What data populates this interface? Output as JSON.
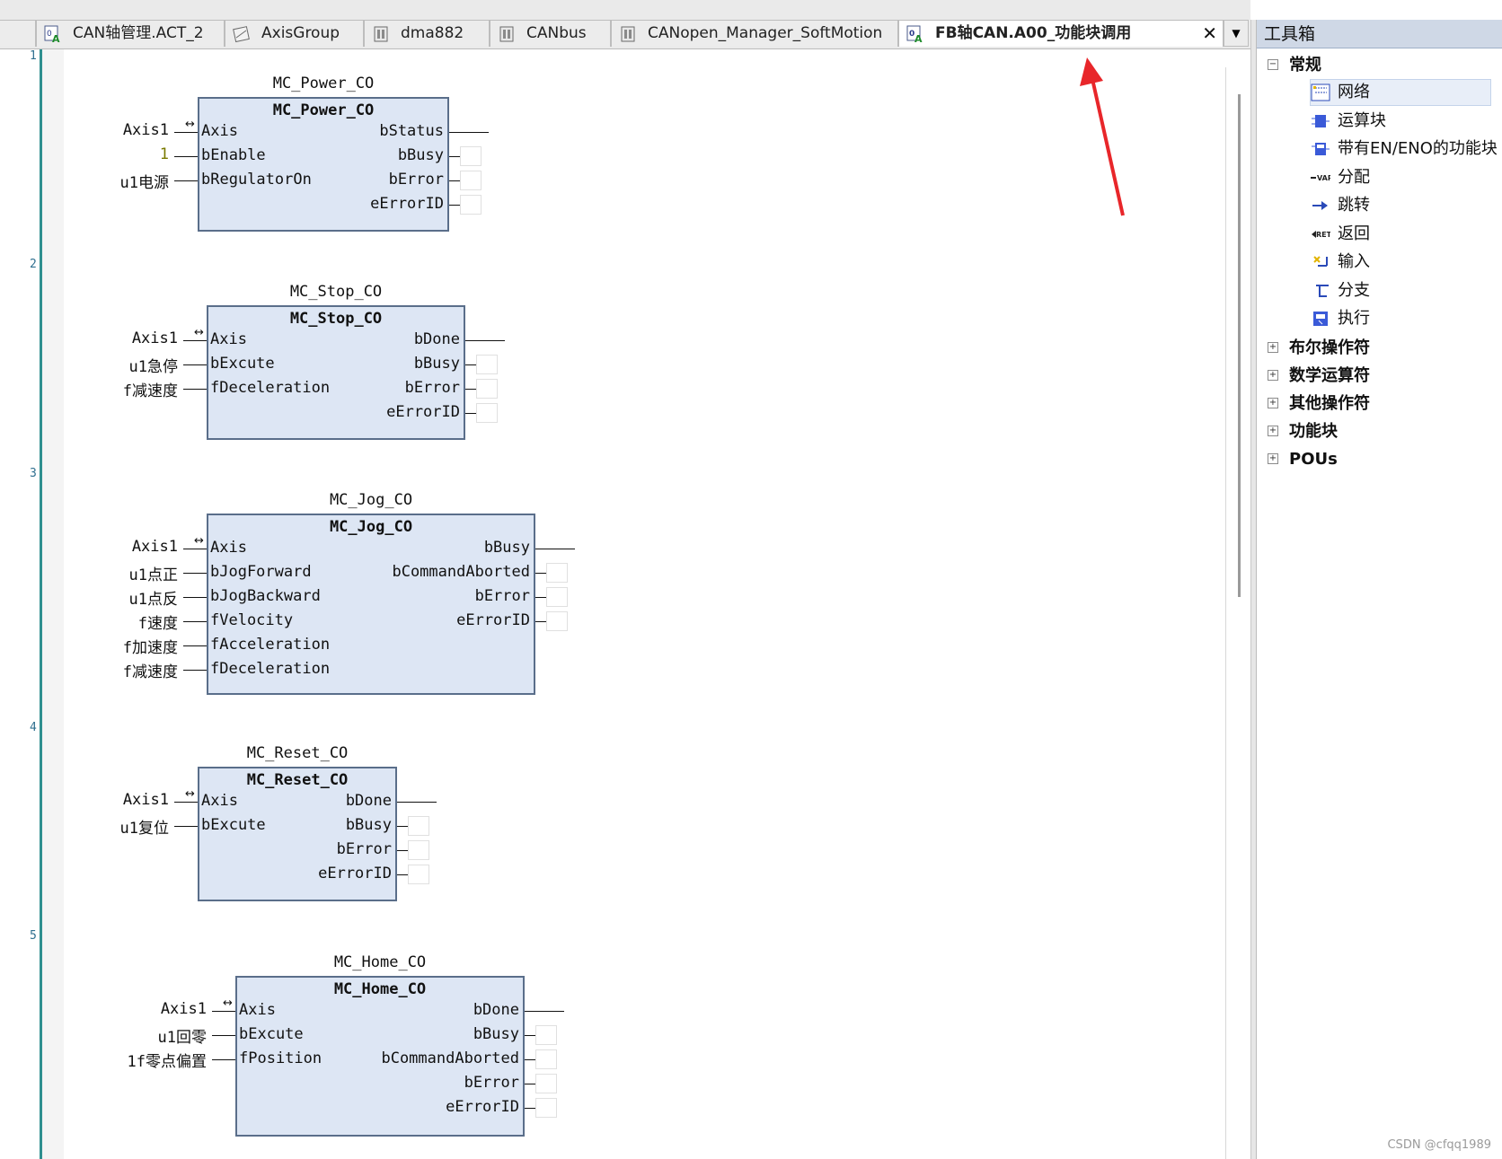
{
  "tabs": [
    {
      "label": "CAN轴管理.ACT_2",
      "icon": "fb-icon"
    },
    {
      "label": "AxisGroup",
      "icon": "axisgroup-icon"
    },
    {
      "label": "dma882",
      "icon": "device-icon"
    },
    {
      "label": "CANbus",
      "icon": "device-icon"
    },
    {
      "label": "CANopen_Manager_SoftMotion",
      "icon": "device-icon"
    },
    {
      "label": "FB轴CAN.A00_功能块调用",
      "icon": "fb-icon",
      "active": true
    }
  ],
  "tab_close": "✕",
  "tab_menu": "▼",
  "networks": [
    "1",
    "2",
    "3",
    "4",
    "5"
  ],
  "blocks": [
    {
      "instance": "MC_Power_CO",
      "type": "MC_Power_CO",
      "inputs": [
        {
          "pin": "Axis",
          "var": "Axis1",
          "inout": true
        },
        {
          "pin": "bEnable",
          "var": "1"
        },
        {
          "pin": "bRegulatorOn",
          "var": "u1电源"
        }
      ],
      "outputs": [
        "bStatus",
        "bBusy",
        "bError",
        "eErrorID"
      ]
    },
    {
      "instance": "MC_Stop_CO",
      "type": "MC_Stop_CO",
      "inputs": [
        {
          "pin": "Axis",
          "var": "Axis1",
          "inout": true
        },
        {
          "pin": "bExcute",
          "var": "u1急停"
        },
        {
          "pin": "fDeceleration",
          "var": "f减速度"
        }
      ],
      "outputs": [
        "bDone",
        "bBusy",
        "bError",
        "eErrorID"
      ]
    },
    {
      "instance": "MC_Jog_CO",
      "type": "MC_Jog_CO",
      "inputs": [
        {
          "pin": "Axis",
          "var": "Axis1",
          "inout": true
        },
        {
          "pin": "bJogForward",
          "var": "u1点正"
        },
        {
          "pin": "bJogBackward",
          "var": "u1点反"
        },
        {
          "pin": "fVelocity",
          "var": "f速度"
        },
        {
          "pin": "fAcceleration",
          "var": "f加速度"
        },
        {
          "pin": "fDeceleration",
          "var": "f减速度"
        }
      ],
      "outputs": [
        "bBusy",
        "bCommandAborted",
        "bError",
        "eErrorID"
      ]
    },
    {
      "instance": "MC_Reset_CO",
      "type": "MC_Reset_CO",
      "inputs": [
        {
          "pin": "Axis",
          "var": "Axis1",
          "inout": true
        },
        {
          "pin": "bExcute",
          "var": "u1复位"
        }
      ],
      "outputs": [
        "bDone",
        "bBusy",
        "bError",
        "eErrorID"
      ]
    },
    {
      "instance": "MC_Home_CO",
      "type": "MC_Home_CO",
      "inputs": [
        {
          "pin": "Axis",
          "var": "Axis1",
          "inout": true
        },
        {
          "pin": "bExcute",
          "var": "u1回零"
        },
        {
          "pin": "fPosition",
          "var": "1f零点偏置"
        }
      ],
      "outputs": [
        "bDone",
        "bBusy",
        "bCommandAborted",
        "bError",
        "eErrorID"
      ]
    }
  ],
  "inout_glyph": "↔",
  "toolbox": {
    "title": "工具箱",
    "groups": [
      {
        "label": "常规",
        "toggle": "−",
        "expanded": true,
        "items": [
          {
            "label": "网络",
            "icon": "network-icon",
            "selected": true
          },
          {
            "label": "运算块",
            "icon": "box-icon"
          },
          {
            "label": "带有EN/ENO的功能块",
            "icon": "box-en-icon"
          },
          {
            "label": "分配",
            "icon": "assign-icon"
          },
          {
            "label": "跳转",
            "icon": "jump-icon"
          },
          {
            "label": "返回",
            "icon": "return-icon"
          },
          {
            "label": "输入",
            "icon": "input-icon"
          },
          {
            "label": "分支",
            "icon": "branch-icon"
          },
          {
            "label": "执行",
            "icon": "execute-icon"
          }
        ]
      },
      {
        "label": "布尔操作符",
        "toggle": "+"
      },
      {
        "label": "数学运算符",
        "toggle": "+"
      },
      {
        "label": "其他操作符",
        "toggle": "+"
      },
      {
        "label": "功能块",
        "toggle": "+"
      },
      {
        "label": "POUs",
        "toggle": "+"
      }
    ]
  },
  "colors": {
    "block_fill": "#dde6f4",
    "block_border": "#5a6e8a",
    "arrow": "#e8262a",
    "gutter": "#2f8f8f"
  },
  "watermark": "CSDN @cfqq1989"
}
